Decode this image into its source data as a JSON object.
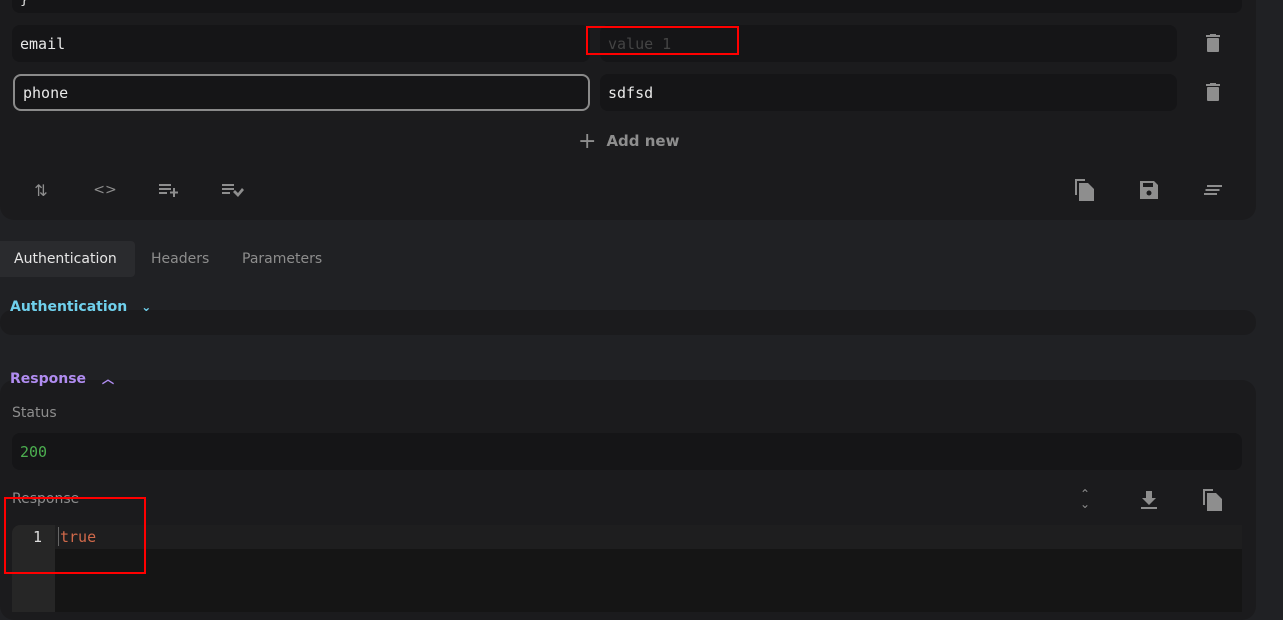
{
  "params": {
    "rows": [
      {
        "key": "email",
        "value": "",
        "value_placeholder": "value 1"
      },
      {
        "key": "phone",
        "value": "sdfsd"
      }
    ],
    "add_new_label": "Add new"
  },
  "tabs": [
    {
      "label": "Authentication",
      "active": true
    },
    {
      "label": "Headers"
    },
    {
      "label": "Parameters"
    }
  ],
  "auth_section": {
    "title": "Authentication",
    "color": "#6fd0ec"
  },
  "response_section": {
    "title": "Response",
    "color": "#b08cf0",
    "status_label": "Status",
    "status_value": "200",
    "status_color": "#4caf50",
    "response_label": "Response",
    "code_lines": [
      {
        "number": "1",
        "text": "true"
      }
    ],
    "code_color": "#d0694a"
  }
}
